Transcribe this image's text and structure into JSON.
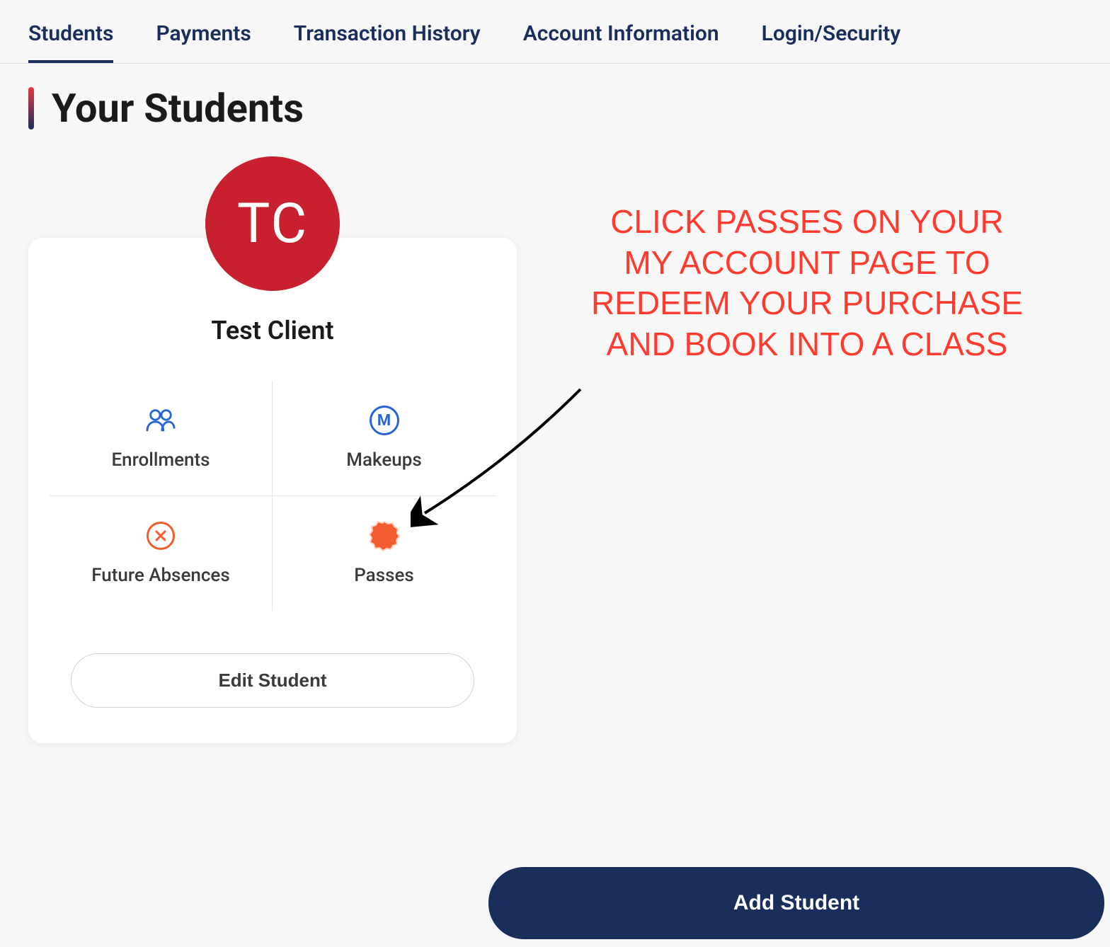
{
  "tabs": [
    {
      "label": "Students",
      "active": true
    },
    {
      "label": "Payments",
      "active": false
    },
    {
      "label": "Transaction History",
      "active": false
    },
    {
      "label": "Account Information",
      "active": false
    },
    {
      "label": "Login/Security",
      "active": false
    }
  ],
  "page": {
    "title": "Your Students"
  },
  "student": {
    "initials": "TC",
    "name": "Test Client",
    "tiles": [
      {
        "label": "Enrollments",
        "icon": "people-icon"
      },
      {
        "label": "Makeups",
        "icon": "makeup-icon"
      },
      {
        "label": "Future Absences",
        "icon": "absence-icon"
      },
      {
        "label": "Passes",
        "icon": "passes-icon"
      }
    ],
    "edit_label": "Edit Student"
  },
  "annotation": {
    "text": "CLICK PASSES ON YOUR MY ACCOUNT PAGE TO REDEEM YOUR PURCHASE AND BOOK INTO A CLASS"
  },
  "buttons": {
    "add_student": "Add Student"
  },
  "colors": {
    "avatar_bg": "#c8202f",
    "primary_navy": "#1a2e5c",
    "annotation_red": "#ff3b30",
    "accent_blue": "#2864d8",
    "accent_orange": "#f25c2e"
  }
}
